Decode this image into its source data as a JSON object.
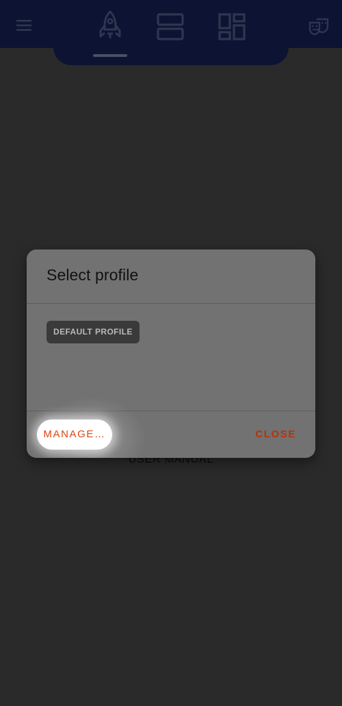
{
  "app_bar": {
    "menu_icon": "hamburger-menu-icon",
    "tabs": [
      {
        "icon": "rocket-icon",
        "selected": true
      },
      {
        "icon": "rows-icon",
        "selected": false
      },
      {
        "icon": "dashboard-icon",
        "selected": false
      }
    ],
    "action_icon": "theater-masks-icon",
    "colors": {
      "bar": "#0d1433",
      "icon": "#2e3650",
      "indicator": "#4a5066"
    }
  },
  "background": {
    "link_label": "USER MANUAL",
    "color": "#2a2a2a"
  },
  "dialog": {
    "title": "Select profile",
    "profiles": [
      {
        "label": "DEFAULT PROFILE"
      }
    ],
    "buttons": {
      "manage_label": "MANAGE…",
      "close_label": "CLOSE"
    },
    "colors": {
      "surface": "#727272",
      "accent": "#e0440e",
      "close": "#b5330b",
      "chip": "#3a3a3a"
    }
  }
}
